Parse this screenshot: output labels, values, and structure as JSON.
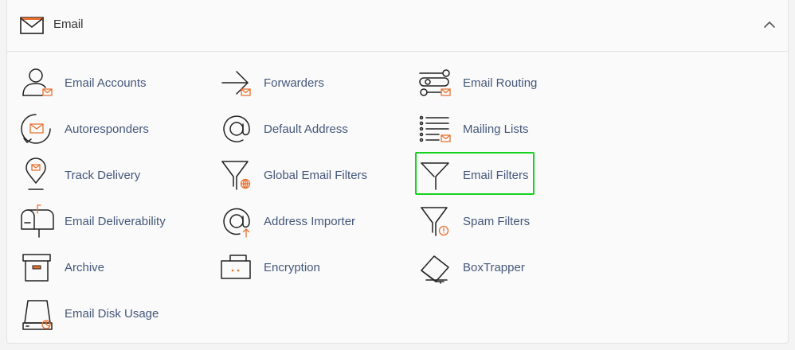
{
  "section": {
    "title": "Email",
    "expanded": true,
    "accent_color": "#e8702f",
    "highlight_color": "#16d31d"
  },
  "items": [
    {
      "label": "Email Accounts",
      "icon": "email-accounts-icon"
    },
    {
      "label": "Forwarders",
      "icon": "forwarders-icon"
    },
    {
      "label": "Email Routing",
      "icon": "email-routing-icon"
    },
    {
      "label": "Autoresponders",
      "icon": "autoresponders-icon"
    },
    {
      "label": "Default Address",
      "icon": "default-address-icon"
    },
    {
      "label": "Mailing Lists",
      "icon": "mailing-lists-icon"
    },
    {
      "label": "Track Delivery",
      "icon": "track-delivery-icon"
    },
    {
      "label": "Global Email Filters",
      "icon": "global-email-filters-icon"
    },
    {
      "label": "Email Filters",
      "icon": "email-filters-icon",
      "highlighted": true
    },
    {
      "label": "Email Deliverability",
      "icon": "email-deliverability-icon"
    },
    {
      "label": "Address Importer",
      "icon": "address-importer-icon"
    },
    {
      "label": "Spam Filters",
      "icon": "spam-filters-icon"
    },
    {
      "label": "Archive",
      "icon": "archive-icon"
    },
    {
      "label": "Encryption",
      "icon": "encryption-icon"
    },
    {
      "label": "BoxTrapper",
      "icon": "boxtrapper-icon"
    },
    {
      "label": "Email Disk Usage",
      "icon": "email-disk-usage-icon"
    }
  ]
}
